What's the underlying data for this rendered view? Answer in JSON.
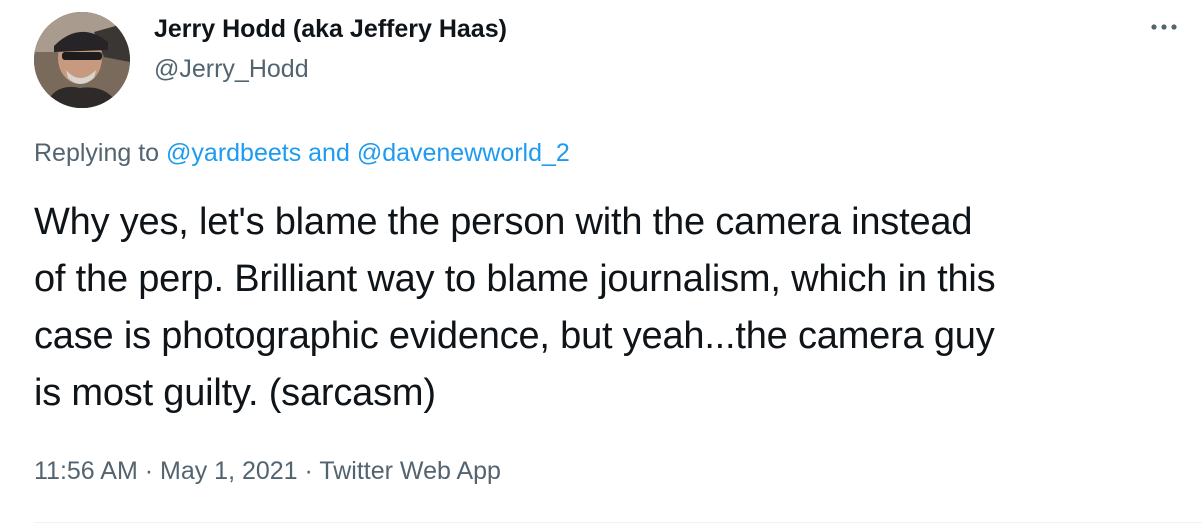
{
  "author": {
    "display_name": "Jerry Hodd (aka Jeffery Haas)",
    "handle": "@Jerry_Hodd",
    "avatar_icon": "profile-photo-avatar"
  },
  "more_icon": "more-horizontal-icon",
  "reply": {
    "prefix": "Replying to ",
    "mention_1": "@yardbeets",
    "conjunction": " and ",
    "mention_2": "@davenewworld_2"
  },
  "tweet": {
    "lines": [
      "Why yes, let's blame the person with the camera instead",
      "of the perp. Brilliant way to blame journalism, which in this",
      "case is photographic evidence, but yeah...the camera guy",
      "is most guilty. (sarcasm)"
    ]
  },
  "meta": {
    "time": "11:56 AM",
    "separator_1": " · ",
    "date": "May 1, 2021",
    "separator_2": " · ",
    "app": "Twitter Web App"
  },
  "colors": {
    "text_primary": "#0f1419",
    "text_secondary": "#536471",
    "link": "#1d9bf0",
    "divider": "#eff3f4"
  }
}
